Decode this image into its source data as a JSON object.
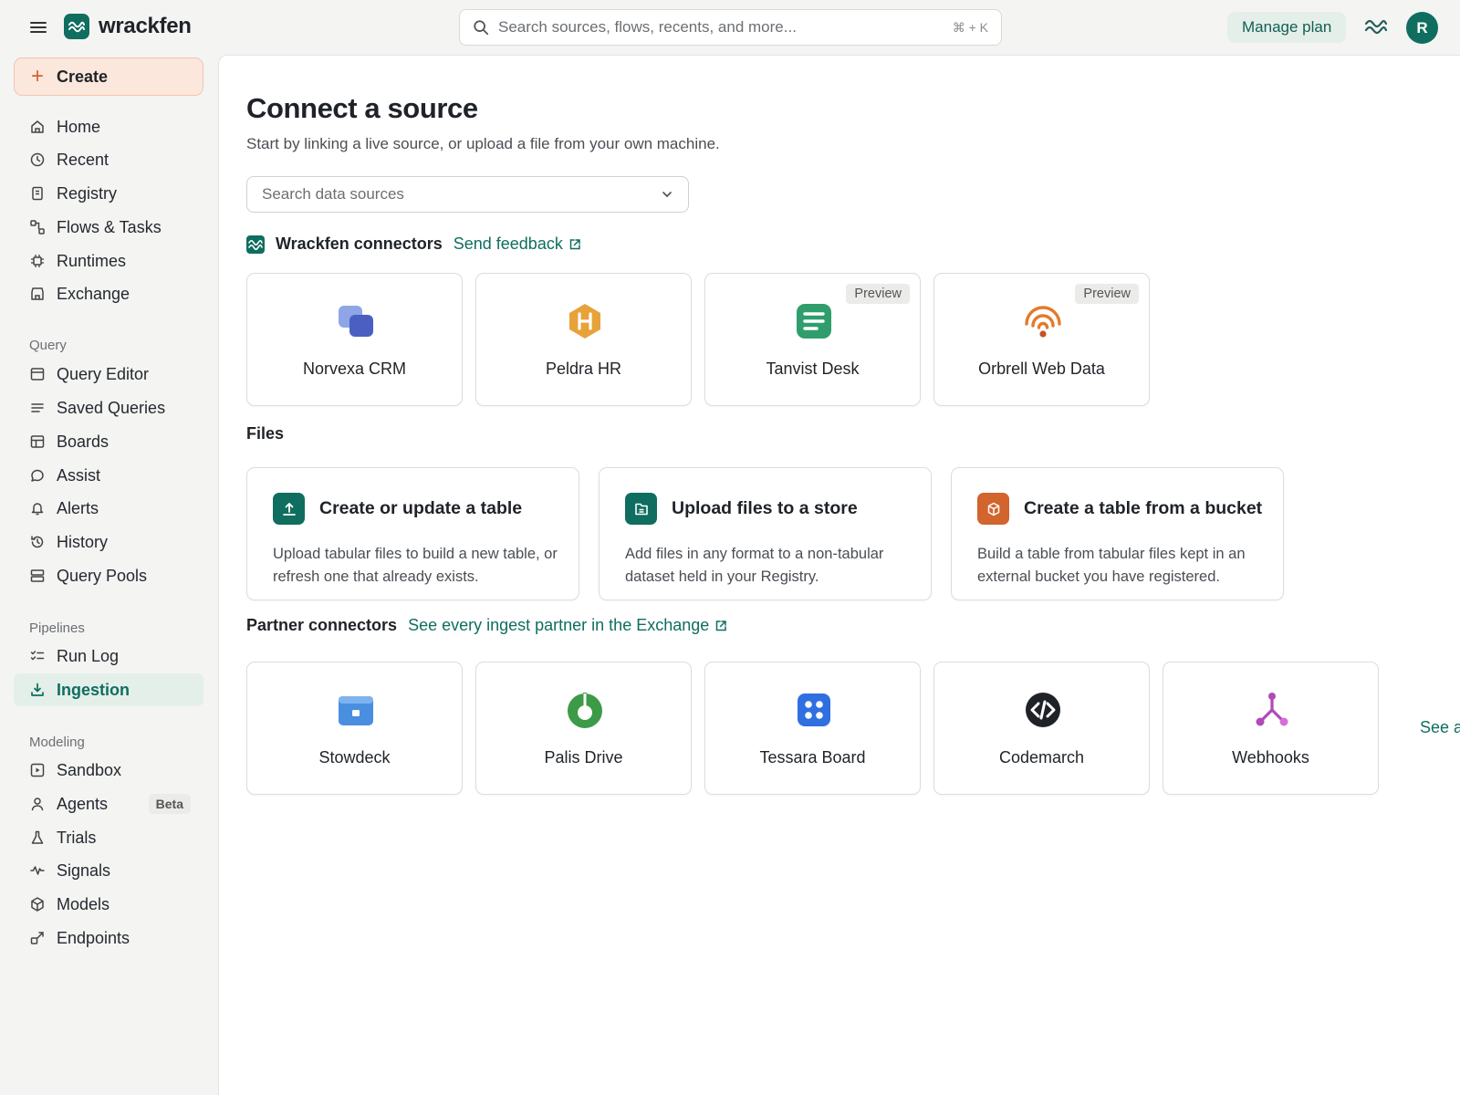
{
  "app": {
    "name": "wrackfen"
  },
  "topbar": {
    "search_placeholder": "Search sources, flows, recents, and more...",
    "search_shortcut": "⌘ + K",
    "manage_plan": "Manage plan",
    "avatar_initial": "R"
  },
  "sidebar": {
    "create_label": "Create",
    "primary": [
      {
        "label": "Home",
        "icon": "home-icon"
      },
      {
        "label": "Recent",
        "icon": "clock-icon"
      },
      {
        "label": "Registry",
        "icon": "registry-icon"
      },
      {
        "label": "Flows & Tasks",
        "icon": "flows-icon"
      },
      {
        "label": "Runtimes",
        "icon": "chip-icon"
      },
      {
        "label": "Exchange",
        "icon": "store-icon"
      }
    ],
    "query_section": "Query",
    "query": [
      {
        "label": "Query Editor",
        "icon": "editor-icon"
      },
      {
        "label": "Saved Queries",
        "icon": "list-icon"
      },
      {
        "label": "Boards",
        "icon": "board-icon"
      },
      {
        "label": "Assist",
        "icon": "chat-icon"
      },
      {
        "label": "Alerts",
        "icon": "bell-icon"
      },
      {
        "label": "History",
        "icon": "history-icon"
      },
      {
        "label": "Query Pools",
        "icon": "server-icon"
      }
    ],
    "pipelines_section": "Pipelines",
    "pipelines": [
      {
        "label": "Run Log",
        "icon": "runlog-icon"
      },
      {
        "label": "Ingestion",
        "icon": "ingestion-icon",
        "active": true
      }
    ],
    "modeling_section": "Modeling",
    "modeling": [
      {
        "label": "Sandbox",
        "icon": "sandbox-icon"
      },
      {
        "label": "Agents",
        "icon": "person-icon",
        "badge": "Beta"
      },
      {
        "label": "Trials",
        "icon": "flask-icon"
      },
      {
        "label": "Signals",
        "icon": "signal-icon"
      },
      {
        "label": "Models",
        "icon": "cube-icon"
      },
      {
        "label": "Endpoints",
        "icon": "endpoint-icon"
      }
    ]
  },
  "main": {
    "title": "Connect a source",
    "subtitle": "Start by linking a live source, or upload a file from your own machine.",
    "source_search_placeholder": "Search data sources",
    "wrackfen_heading": "Wrackfen connectors",
    "send_feedback": "Send feedback",
    "connectors": [
      {
        "name": "Norvexa CRM",
        "icon": "norvexa-logo-icon"
      },
      {
        "name": "Peldra HR",
        "icon": "peldra-logo-icon"
      },
      {
        "name": "Tanvist Desk",
        "icon": "tanvist-logo-icon",
        "badge": "Preview"
      },
      {
        "name": "Orbrell Web Data",
        "icon": "orbrell-logo-icon",
        "badge": "Preview"
      }
    ],
    "files_heading": "Files",
    "files": [
      {
        "title": "Create or update a table",
        "description": "Upload tabular files to build a new table, or refresh one that already exists.",
        "icon": "upload-icon",
        "color": "#0f6e5f"
      },
      {
        "title": "Upload files to a store",
        "description": "Add files in any format to a non-tabular dataset held in your Registry.",
        "icon": "file-icon",
        "color": "#0f6e5f"
      },
      {
        "title": "Create a table from a bucket",
        "description": "Build a table from tabular files kept in an external bucket you have registered.",
        "icon": "box-icon",
        "color": "#d2642d"
      }
    ],
    "partner_heading": "Partner connectors",
    "partner_link": "See every ingest partner in the Exchange",
    "partners": [
      {
        "name": "Stowdeck",
        "icon": "stowdeck-logo-icon"
      },
      {
        "name": "Palis Drive",
        "icon": "palis-logo-icon"
      },
      {
        "name": "Tessara Board",
        "icon": "tessara-logo-icon"
      },
      {
        "name": "Codemarch",
        "icon": "codemarch-logo-icon"
      },
      {
        "name": "Webhooks",
        "icon": "webhooks-icon"
      }
    ],
    "see_all": "See a"
  },
  "colors": {
    "brand": "#0f6e5f",
    "accent_orange": "#d2642d",
    "create_bg": "#fbe7dc",
    "active_bg": "#e4efe9"
  }
}
